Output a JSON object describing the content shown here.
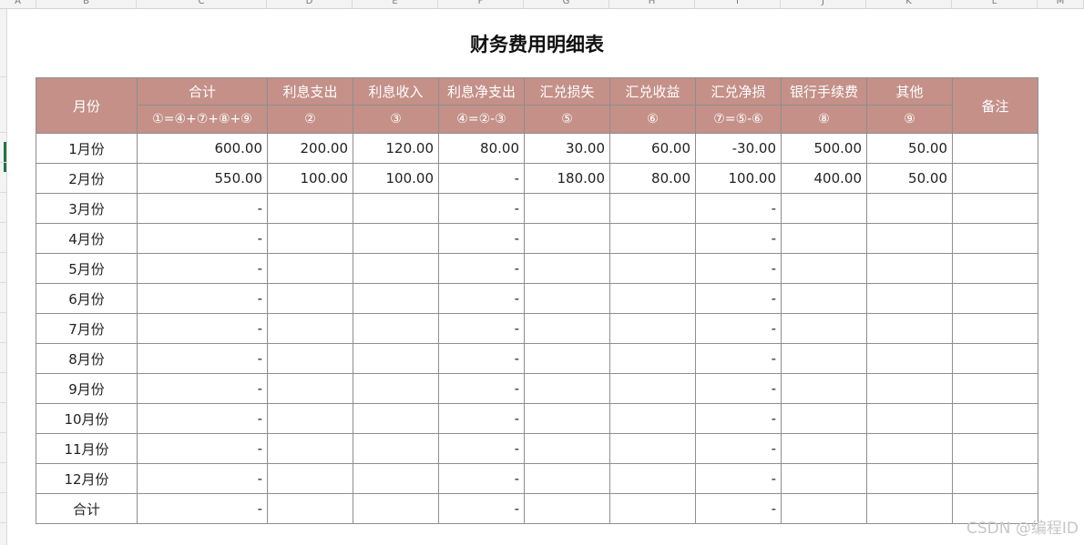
{
  "column_letters": [
    "A",
    "B",
    "C",
    "D",
    "E",
    "F",
    "G",
    "H",
    "I",
    "J",
    "K",
    "L",
    "M"
  ],
  "title": "财务费用明细表",
  "headers": {
    "month": "月份",
    "remark": "备注",
    "columns": [
      {
        "name": "合计",
        "code": "①=④+⑦+⑧+⑨"
      },
      {
        "name": "利息支出",
        "code": "②"
      },
      {
        "name": "利息收入",
        "code": "③"
      },
      {
        "name": "利息净支出",
        "code": "④=②-③"
      },
      {
        "name": "汇兑损失",
        "code": "⑤"
      },
      {
        "name": "汇兑收益",
        "code": "⑥"
      },
      {
        "name": "汇兑净损",
        "code": "⑦=⑤-⑥"
      },
      {
        "name": "银行手续费",
        "code": "⑧"
      },
      {
        "name": "其他",
        "code": "⑨"
      }
    ]
  },
  "rows": [
    {
      "month": "1月份",
      "values": [
        "600.00",
        "200.00",
        "120.00",
        "80.00",
        "30.00",
        "60.00",
        "-30.00",
        "500.00",
        "50.00"
      ],
      "remark": ""
    },
    {
      "month": "2月份",
      "values": [
        "550.00",
        "100.00",
        "100.00",
        "-",
        "180.00",
        "80.00",
        "100.00",
        "400.00",
        "50.00"
      ],
      "remark": ""
    },
    {
      "month": "3月份",
      "values": [
        "-",
        "",
        "",
        "-",
        "",
        "",
        "-",
        "",
        ""
      ],
      "remark": ""
    },
    {
      "month": "4月份",
      "values": [
        "-",
        "",
        "",
        "-",
        "",
        "",
        "-",
        "",
        ""
      ],
      "remark": ""
    },
    {
      "month": "5月份",
      "values": [
        "-",
        "",
        "",
        "-",
        "",
        "",
        "-",
        "",
        ""
      ],
      "remark": ""
    },
    {
      "month": "6月份",
      "values": [
        "-",
        "",
        "",
        "-",
        "",
        "",
        "-",
        "",
        ""
      ],
      "remark": ""
    },
    {
      "month": "7月份",
      "values": [
        "-",
        "",
        "",
        "-",
        "",
        "",
        "-",
        "",
        ""
      ],
      "remark": ""
    },
    {
      "month": "8月份",
      "values": [
        "-",
        "",
        "",
        "-",
        "",
        "",
        "-",
        "",
        ""
      ],
      "remark": ""
    },
    {
      "month": "9月份",
      "values": [
        "-",
        "",
        "",
        "-",
        "",
        "",
        "-",
        "",
        ""
      ],
      "remark": ""
    },
    {
      "month": "10月份",
      "values": [
        "-",
        "",
        "",
        "-",
        "",
        "",
        "-",
        "",
        ""
      ],
      "remark": ""
    },
    {
      "month": "11月份",
      "values": [
        "-",
        "",
        "",
        "-",
        "",
        "",
        "-",
        "",
        ""
      ],
      "remark": ""
    },
    {
      "month": "12月份",
      "values": [
        "-",
        "",
        "",
        "-",
        "",
        "",
        "-",
        "",
        ""
      ],
      "remark": ""
    },
    {
      "month": "合计",
      "values": [
        "-",
        "",
        "",
        "-",
        "",
        "",
        "-",
        "",
        ""
      ],
      "remark": ""
    }
  ],
  "watermark": "CSDN @编程ID",
  "colors": {
    "header_fill": "#c49088",
    "header_text": "#ffffff",
    "grid": "#8e8e8e",
    "selected_row_marker": "#217346"
  }
}
